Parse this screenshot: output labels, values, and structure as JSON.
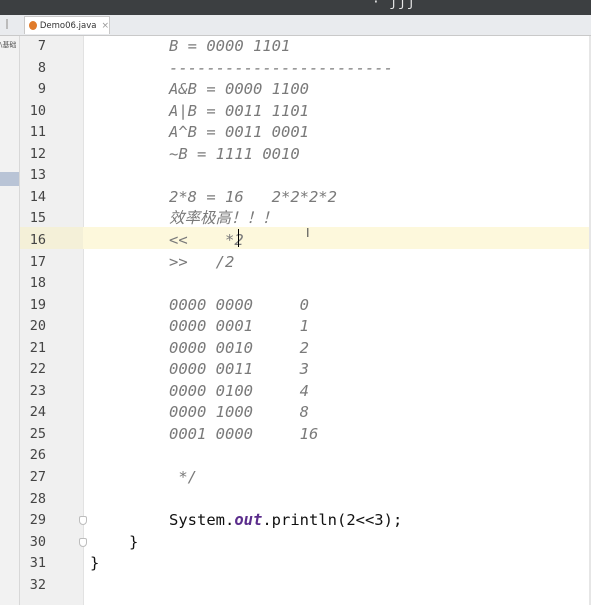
{
  "window": {
    "top_glyphs": "· ʃʃʃ"
  },
  "tab": {
    "label": "Demo06.java",
    "close": "×"
  },
  "project_panel": {
    "cropped_label": "\\基础"
  },
  "editor": {
    "lines": [
      {
        "n": "7",
        "text": "B = 0000 1101",
        "style": "cmt"
      },
      {
        "n": "8",
        "text": "------------------------",
        "style": "cmt"
      },
      {
        "n": "9",
        "text": "A&B = 0000 1100",
        "style": "cmt"
      },
      {
        "n": "10",
        "text": "A|B = 0011 1101",
        "style": "cmt"
      },
      {
        "n": "11",
        "text": "A^B = 0011 0001",
        "style": "cmt"
      },
      {
        "n": "12",
        "text": "~B = 1111 0010",
        "style": "cmt"
      },
      {
        "n": "13",
        "text": "",
        "style": "cmt"
      },
      {
        "n": "14",
        "text": "2*8 = 16   2*2*2*2",
        "style": "cmt"
      },
      {
        "n": "15",
        "text": "效率极高！！！",
        "style": "cmt"
      },
      {
        "n": "16",
        "text": "<<    *2",
        "style": "cmt"
      },
      {
        "n": "17",
        "text": ">>   /2",
        "style": "cmt"
      },
      {
        "n": "18",
        "text": "",
        "style": "cmt"
      },
      {
        "n": "19",
        "text": "0000 0000     0",
        "style": "cmt"
      },
      {
        "n": "20",
        "text": "0000 0001     1",
        "style": "cmt"
      },
      {
        "n": "21",
        "text": "0000 0010     2",
        "style": "cmt"
      },
      {
        "n": "22",
        "text": "0000 0011     3",
        "style": "cmt"
      },
      {
        "n": "23",
        "text": "0000 0100     4",
        "style": "cmt"
      },
      {
        "n": "24",
        "text": "0000 1000     8",
        "style": "cmt"
      },
      {
        "n": "25",
        "text": "0001 0000     16",
        "style": "cmt"
      },
      {
        "n": "26",
        "text": "",
        "style": "cmt"
      },
      {
        "n": "27",
        "text": " */",
        "style": "cmt"
      },
      {
        "n": "28",
        "text": "",
        "style": "cmt"
      },
      {
        "n": "29",
        "text": "",
        "style": "plain"
      },
      {
        "n": "30",
        "text": "}",
        "style": "plain"
      },
      {
        "n": "31",
        "text": "}",
        "style": "plain"
      },
      {
        "n": "32",
        "text": "",
        "style": "plain"
      }
    ],
    "println_line": {
      "prefix": "System.",
      "field": "out",
      "suffix": ".println(2<<3);"
    },
    "ibeam": "I"
  }
}
